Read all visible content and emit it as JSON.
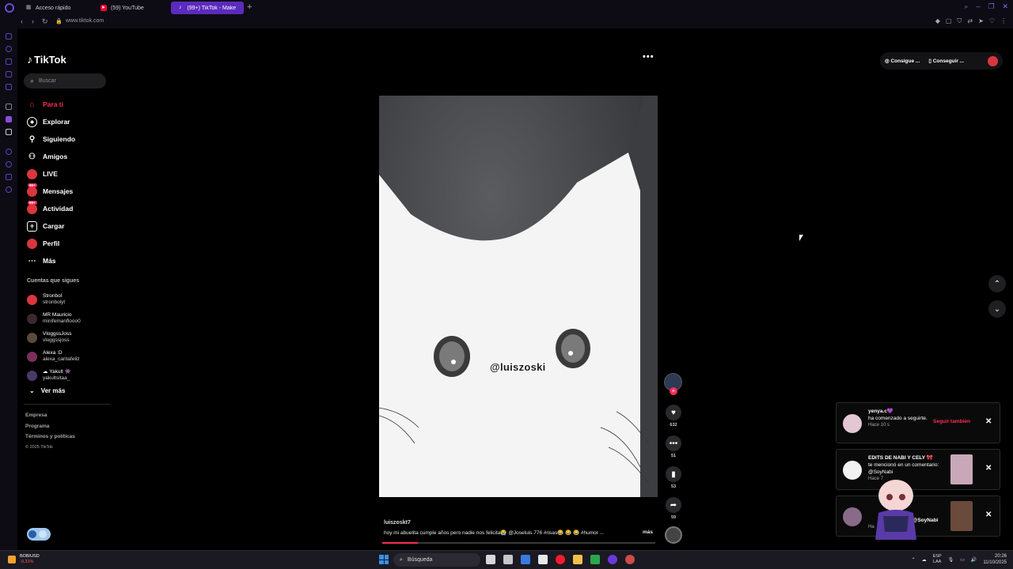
{
  "browser": {
    "tabs": [
      {
        "label": "Acceso rápido",
        "active": false
      },
      {
        "label": "(59) YouTube",
        "active": false
      },
      {
        "label": "(99+) TikTok - Make Y",
        "active": true
      }
    ],
    "new_tab": "+",
    "url": "www.tiktok.com"
  },
  "tiktok": {
    "logo": "TikTok",
    "search_placeholder": "Buscar",
    "nav": [
      {
        "label": "Para ti",
        "icon": "home-icon",
        "active": true
      },
      {
        "label": "Explorar",
        "icon": "compass-icon"
      },
      {
        "label": "Siguiendo",
        "icon": "user-follow-icon"
      },
      {
        "label": "Amigos",
        "icon": "friends-icon"
      },
      {
        "label": "LIVE",
        "icon": "live-icon"
      },
      {
        "label": "Mensajes",
        "icon": "messages-icon",
        "badge": "99+"
      },
      {
        "label": "Actividad",
        "icon": "activity-icon",
        "badge": "99+"
      },
      {
        "label": "Cargar",
        "icon": "upload-icon"
      },
      {
        "label": "Perfil",
        "icon": "profile-icon"
      },
      {
        "label": "Más",
        "icon": "more-icon"
      }
    ],
    "following_title": "Cuentas que sigues",
    "following": [
      {
        "name": "Stronbol",
        "handle": "stronbolyt"
      },
      {
        "name": "MR Mauricio",
        "handle": "minifemanflooo0"
      },
      {
        "name": "VloggssJoss",
        "handle": "vloggssjoss"
      },
      {
        "name": "Alexa :D",
        "handle": "alexa_caritafeliz"
      },
      {
        "name": "☁ Yakult 👾",
        "handle": "yakultsitaa_"
      }
    ],
    "see_more": "Ver más",
    "footer": [
      "Empresa",
      "Programa",
      "Términos y políticas"
    ],
    "copyright": "© 2025 TikTok",
    "top_right": {
      "get_coins": "Consigue ...",
      "get_app": "Conseguir ..."
    },
    "video": {
      "watermark": "@luiszoski",
      "author": "luiszoskt7",
      "caption": "hoy mi abuelita cumple años pero nadie nos felicita😭 @Joseluis.776  #risas😂 😂 😂  #humor ...",
      "more": "más",
      "progress": 0.13,
      "likes": "632",
      "comments": "51",
      "saves": "53",
      "shares": "59"
    },
    "notifications": [
      {
        "user": "yenya.c💜",
        "text": "ha comenzado a seguirte.",
        "time": "Hace 10 s",
        "action": "Seguir también"
      },
      {
        "user": "EDITS DE NABI Y CELY 🎀",
        "text": "te mencionó en un comentario: @SoyNabi",
        "time": "Hace 7"
      },
      {
        "user": "",
        "text": "@SoyNabi",
        "time": "Ha"
      }
    ]
  },
  "taskbar": {
    "ticker": "BOB/USD",
    "ticker_change": "-0,31%",
    "search_placeholder": "Búsqueda",
    "lang_top": "ESP",
    "lang_bottom": "LAA",
    "time": "20:26",
    "date": "11/10/2025"
  },
  "colors": {
    "accent": "#fe2c55",
    "browser_accent": "#5b2bbd"
  }
}
